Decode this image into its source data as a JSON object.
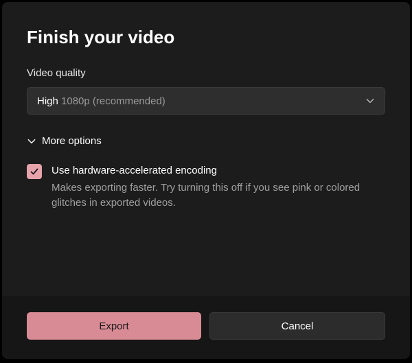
{
  "dialog": {
    "title": "Finish your video"
  },
  "quality": {
    "label": "Video quality",
    "selected_primary": "High",
    "selected_secondary": " 1080p (recommended)"
  },
  "more_options": {
    "label": "More options"
  },
  "hardware_encoding": {
    "checked": true,
    "label": "Use hardware-accelerated encoding",
    "description": "Makes exporting faster. Try turning this off if you see pink or colored glitches in exported videos."
  },
  "buttons": {
    "export": "Export",
    "cancel": "Cancel"
  },
  "colors": {
    "accent": "#d98b95",
    "background": "#1c1c1c",
    "footer": "#161616"
  }
}
